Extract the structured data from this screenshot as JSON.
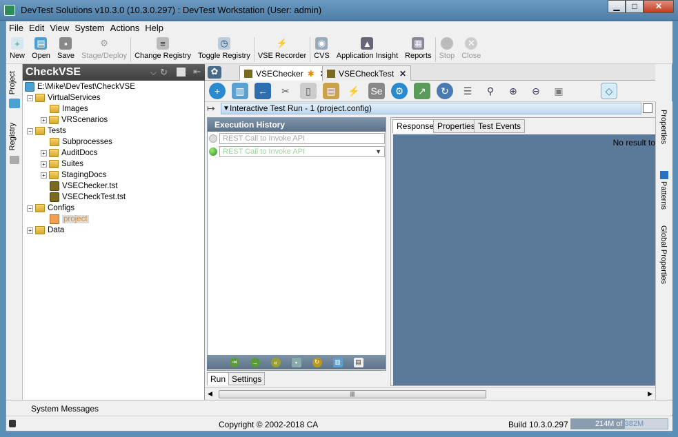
{
  "window": {
    "title": "DevTest Solutions v10.3.0 (10.3.0.297) : DevTest Workstation (User: admin)",
    "minimize": "▁",
    "maximize": "□",
    "close": "✕"
  },
  "menu": [
    "File",
    "Edit",
    "View",
    "System",
    "Actions",
    "Help"
  ],
  "toolbar": {
    "new": "New",
    "open": "Open",
    "save": "Save",
    "stage_deploy": "Stage/Deploy",
    "change_registry": "Change Registry",
    "toggle_registry": "Toggle Registry",
    "vse_recorder": "VSE Recorder",
    "cvs": "CVS",
    "application_insight": "Application Insight",
    "reports": "Reports",
    "stop": "Stop",
    "close": "Close"
  },
  "left_tabs": {
    "project": "Project",
    "registry": "Registry"
  },
  "project": {
    "title": "CheckVSE",
    "tree": {
      "root": "E:\\Mike\\DevTest\\CheckVSE",
      "virtual_services": "VirtualServices",
      "images": "Images",
      "vrscenarios": "VRScenarios",
      "tests": "Tests",
      "subprocesses": "Subprocesses",
      "auditdocs": "AuditDocs",
      "suites": "Suites",
      "stagingdocs": "StagingDocs",
      "vsechecker_tst": "VSEChecker.tst",
      "vsechecktest_tst": "VSECheckTest.tst",
      "configs": "Configs",
      "project": "project",
      "data": "Data"
    }
  },
  "editor_tabs": [
    {
      "label": "VSEChecker",
      "modified": "✱"
    },
    {
      "label": "VSECheckTest"
    }
  ],
  "itr": {
    "header": "Interactive Test Run - 1 (project.config)"
  },
  "execution_history": {
    "title": "Execution History",
    "rows": [
      "REST Call to Invoke API",
      "REST Call to Invoke API"
    ]
  },
  "run_tabs": {
    "run": "Run",
    "settings": "Settings"
  },
  "result_tabs": {
    "response": "Response",
    "properties": "Properties",
    "test_events": "Test Events"
  },
  "result": {
    "empty_text": "No result to"
  },
  "right_tabs": {
    "properties": "Properties",
    "patterns": "Patterns",
    "global_properties": "Global Properties"
  },
  "system_messages": "System Messages",
  "status": {
    "copyright": "Copyright © 2002-2018 CA",
    "build": "Build 10.3.0.297",
    "mem_used": "214M of ",
    "mem_total": "382M",
    "mem_fraction": 0.56
  }
}
